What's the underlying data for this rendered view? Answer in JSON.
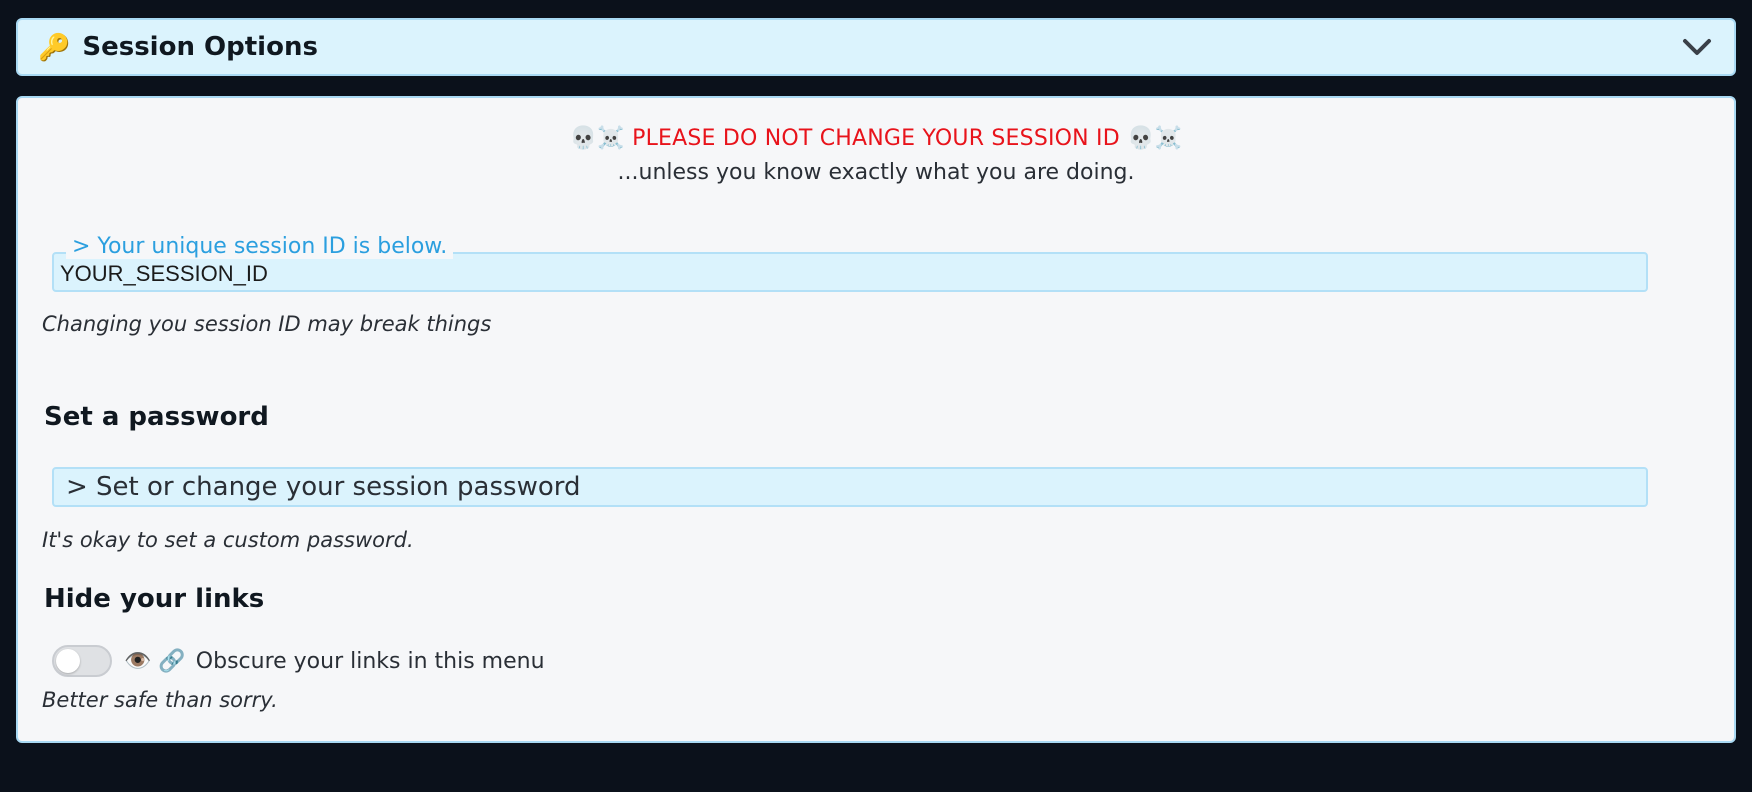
{
  "header": {
    "icon": "🔑",
    "title": "Session Options",
    "chevron_icon": "chevron-down-icon"
  },
  "warning": {
    "prefix_emoji": "💀☠️",
    "text": "PLEASE DO NOT CHANGE YOUR SESSION ID",
    "suffix_emoji": "💀☠️",
    "subtext": "...unless you know exactly what you are doing."
  },
  "session_id": {
    "legend": "> Your unique session ID is below.",
    "value": "YOUR_SESSION_ID",
    "hint": "Changing you session ID may break things"
  },
  "password": {
    "heading": "Set a password",
    "placeholder": "> Set or change your session password",
    "hint": "It's okay to set a custom password."
  },
  "hide_links": {
    "heading": "Hide your links",
    "toggle_state": "off",
    "emoji": "👁️ 🔗",
    "label": "Obscure your links in this menu",
    "hint": "Better safe than sorry."
  },
  "colors": {
    "background": "#0b111b",
    "header_bg": "#dbf3fd",
    "panel_bg": "#f6f7f9",
    "warning": "#e8131b",
    "legend": "#2b9fdf"
  }
}
